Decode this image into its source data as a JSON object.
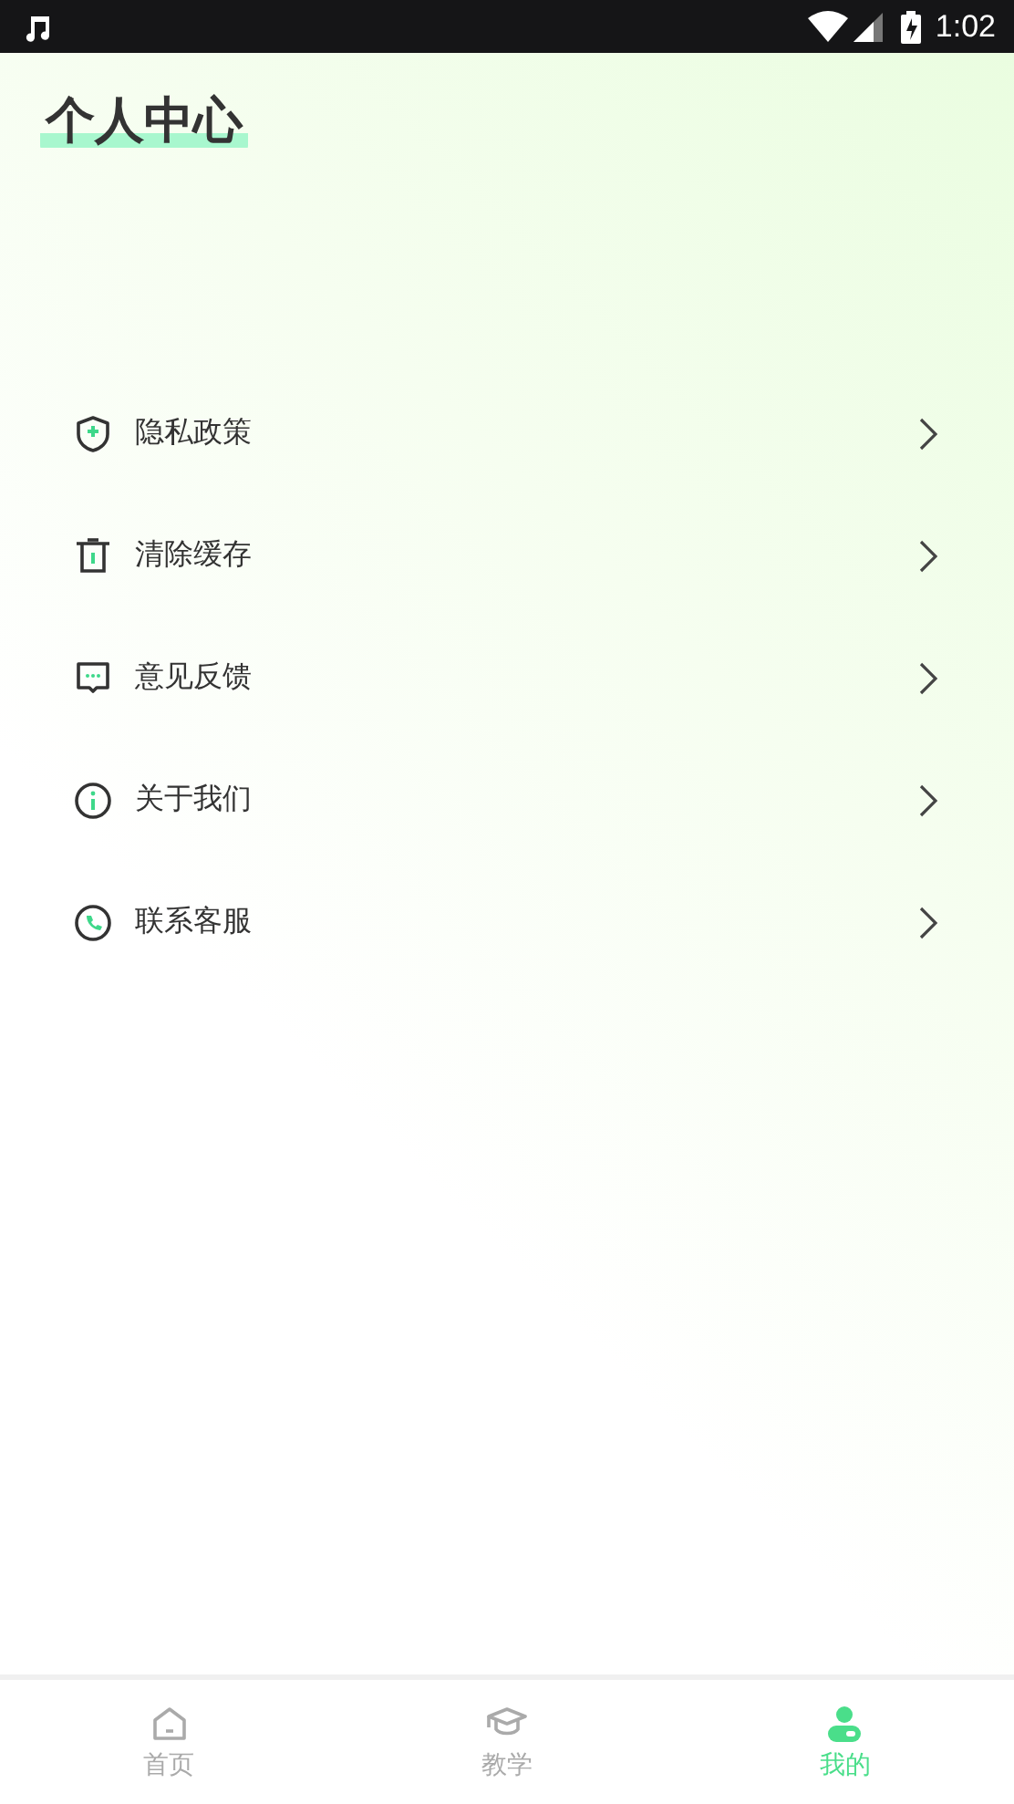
{
  "status_bar": {
    "time": "1:02"
  },
  "title": "个人中心",
  "menu": [
    {
      "kind": "shield",
      "label": "隐私政策"
    },
    {
      "kind": "trash",
      "label": "清除缓存"
    },
    {
      "kind": "chat",
      "label": "意见反馈"
    },
    {
      "kind": "info",
      "label": "关于我们"
    },
    {
      "kind": "phone",
      "label": "联系客服"
    }
  ],
  "tabs": [
    {
      "kind": "home",
      "label": "首页",
      "selected": false
    },
    {
      "kind": "cap",
      "label": "教学",
      "selected": false
    },
    {
      "kind": "person",
      "label": "我的",
      "selected": true
    }
  ]
}
